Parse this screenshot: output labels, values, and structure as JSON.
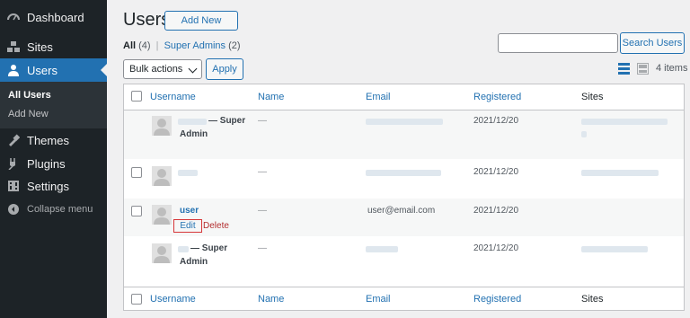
{
  "sidebar": {
    "items": [
      {
        "label": "Dashboard",
        "icon": "dashboard-icon"
      },
      {
        "label": "Sites",
        "icon": "sites-icon"
      },
      {
        "label": "Users",
        "icon": "users-icon"
      },
      {
        "label": "Themes",
        "icon": "themes-icon"
      },
      {
        "label": "Plugins",
        "icon": "plugins-icon"
      },
      {
        "label": "Settings",
        "icon": "settings-icon"
      }
    ],
    "submenu": [
      "All Users",
      "Add New"
    ],
    "collapse": "Collapse menu"
  },
  "header": {
    "title": "Users",
    "add_new": "Add New"
  },
  "filters": {
    "all": "All",
    "all_count": "(4)",
    "separator": "|",
    "super_admins": "Super Admins",
    "super_admins_count": "(2)"
  },
  "search": {
    "button": "Search Users",
    "value": ""
  },
  "bulk": {
    "selected": "Bulk actions",
    "apply": "Apply"
  },
  "items_count": "4 items",
  "columns": [
    "Username",
    "Name",
    "Email",
    "Registered",
    "Sites"
  ],
  "rows": [
    {
      "username_suffix": "— Super",
      "username_suffix2": "Admin",
      "name": "—",
      "registered": "2021/12/20"
    },
    {
      "name": "—",
      "registered": "2021/12/20"
    },
    {
      "username": "user",
      "name": "—",
      "email": "user@email.com",
      "registered": "2021/12/20",
      "actions": {
        "edit": "Edit",
        "delete": "Delete"
      }
    },
    {
      "username_suffix": "— Super",
      "username_suffix2": "Admin",
      "name": "—",
      "registered": "2021/12/20"
    }
  ],
  "colors": {
    "sidebar": "#1d2327",
    "accent": "#2271b1",
    "highlight": "#d63638"
  }
}
